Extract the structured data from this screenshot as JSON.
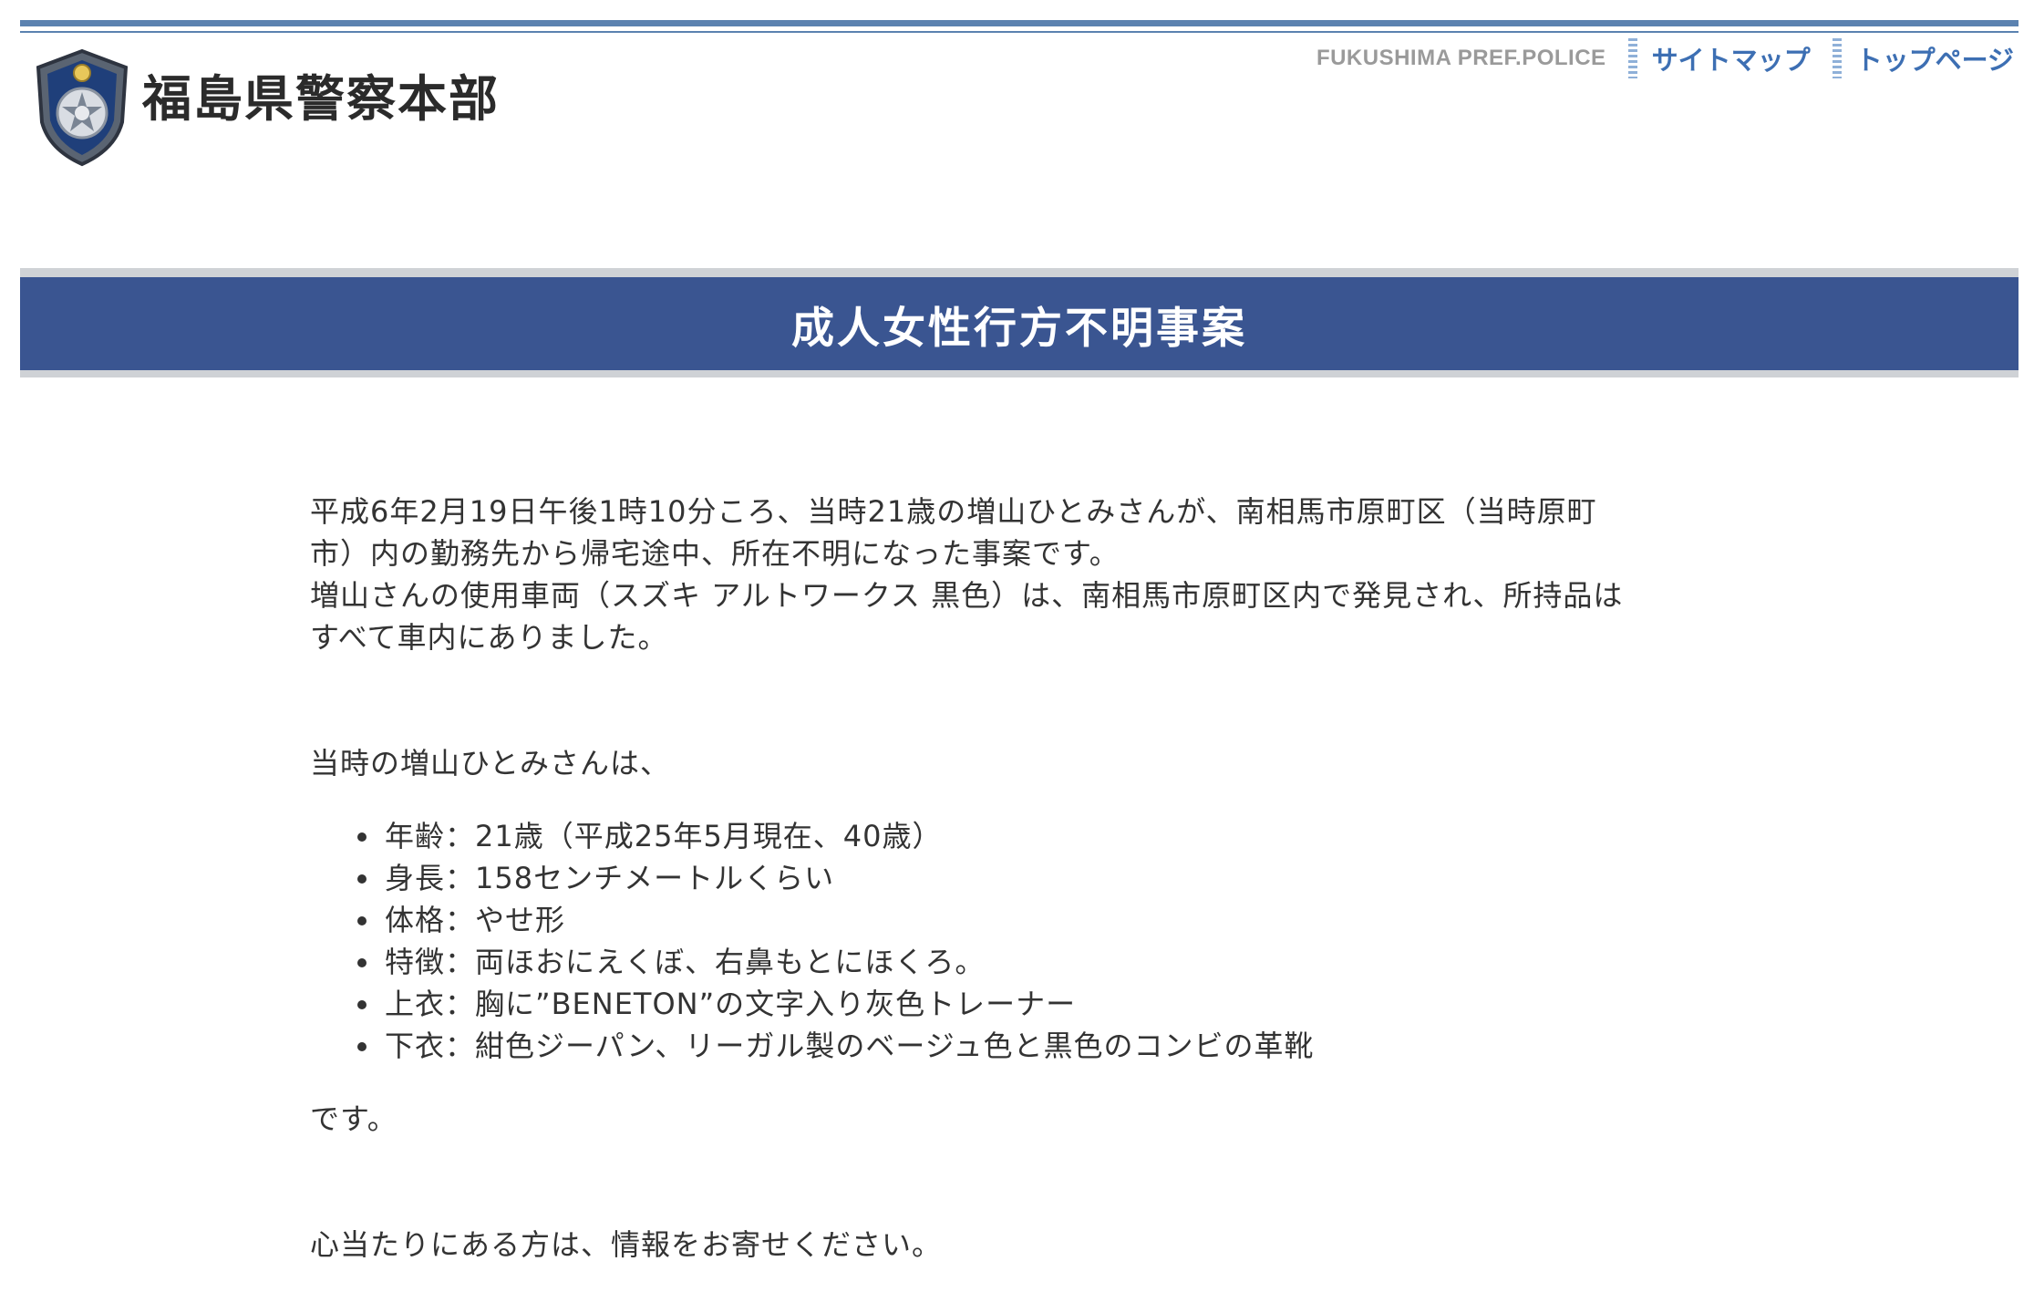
{
  "header": {
    "site_title": "福島県警察本部",
    "brand_en": "FUKUSHIMA PREF.POLICE",
    "links": [
      {
        "label": "サイトマップ"
      },
      {
        "label": "トップページ"
      }
    ]
  },
  "banner": {
    "title": "成人女性行方不明事案"
  },
  "content": {
    "intro_lines": [
      "平成6年2月19日午後1時10分ころ、当時21歳の増山ひとみさんが、南相馬市原町区（当時原町",
      "市）内の勤務先から帰宅途中、所在不明になった事案です。",
      "増山さんの使用車両（スズキ アルトワークス 黒色）は、南相馬市原町区内で発見され、所持品は",
      "すべて車内にありました。"
    ],
    "features_intro": "当時の増山ひとみさんは、",
    "features": [
      "年齢：21歳（平成25年5月現在、40歳）",
      "身長：158センチメートルくらい",
      "体格：やせ形",
      "特徴：両ほおにえくぼ、右鼻もとにほくろ。",
      "上衣：胸に”BENETON”の文字入り灰色トレーナー",
      "下衣：紺色ジーパン、リーガル製のベージュ色と黒色のコンビの革靴"
    ],
    "features_end": "です。",
    "closing": "心当たりにある方は、情報をお寄せください。"
  }
}
